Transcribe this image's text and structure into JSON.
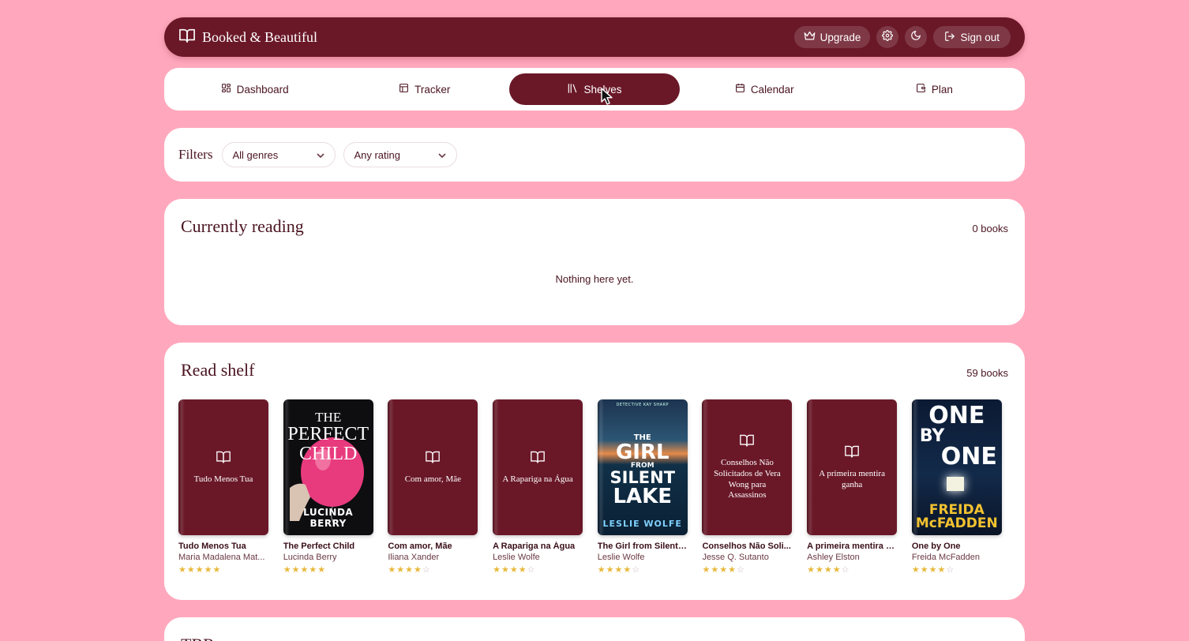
{
  "app": {
    "name": "Booked & Beautiful",
    "upgrade_label": "Upgrade",
    "signout_label": "Sign out"
  },
  "nav": {
    "tabs": [
      {
        "label": "Dashboard",
        "icon": "dashboard-icon"
      },
      {
        "label": "Tracker",
        "icon": "table-icon"
      },
      {
        "label": "Shelves",
        "icon": "library-icon",
        "active": true
      },
      {
        "label": "Calendar",
        "icon": "calendar-icon"
      },
      {
        "label": "Plan",
        "icon": "wallet-icon"
      }
    ]
  },
  "filters": {
    "label": "Filters",
    "genre_value": "All genres",
    "rating_value": "Any rating"
  },
  "currently_reading": {
    "title": "Currently reading",
    "count": "0 books",
    "empty_message": "Nothing here yet."
  },
  "read_shelf": {
    "title": "Read shelf",
    "count": "59 books",
    "books": [
      {
        "title": "Tudo Menos Tua",
        "author": "Maria Madalena Mat...",
        "cover_text": "Tudo Menos Tua",
        "rating": 5
      },
      {
        "title": "The Perfect Child",
        "author": "Lucinda Berry",
        "cover_lines": [
          "THE",
          "PERFECT",
          "CHILD"
        ],
        "cover_author": "LUCINDA BERRY",
        "rating": 5
      },
      {
        "title": "Com amor, Mãe",
        "author": "Iliana Xander",
        "cover_text": "Com amor, Mãe",
        "rating": 4
      },
      {
        "title": "A Rapariga na Água",
        "author": "Leslie Wolfe",
        "cover_text": "A Rapariga na Água",
        "rating": 4
      },
      {
        "title": "The Girl from Silent ...",
        "author": "Leslie Wolfe",
        "cover_lines": [
          "THE",
          "GIRL",
          "FROM",
          "SILENT",
          "LAKE"
        ],
        "cover_series": "DETECTIVE KAY SHARP",
        "cover_author": "LESLIE WOLFE",
        "rating": 4
      },
      {
        "title": "Conselhos Não Soli...",
        "author": "Jesse Q. Sutanto",
        "cover_text": "Conselhos Não Solicitados de Vera Wong para Assassinos",
        "rating": 4
      },
      {
        "title": "A primeira mentira g...",
        "author": "Ashley Elston",
        "cover_text": "A primeira mentira ganha",
        "rating": 4
      },
      {
        "title": "One by One",
        "author": "Freida McFadden",
        "cover_lines": [
          "ONE",
          "BY",
          "ONE"
        ],
        "cover_author_lines": [
          "FREIDA",
          "McFADDEN"
        ],
        "rating": 4
      }
    ]
  },
  "next_section": {
    "title": "TBR"
  },
  "colors": {
    "background": "#ffa8bd",
    "primary": "#6a1828",
    "star": "#e8b83a"
  }
}
